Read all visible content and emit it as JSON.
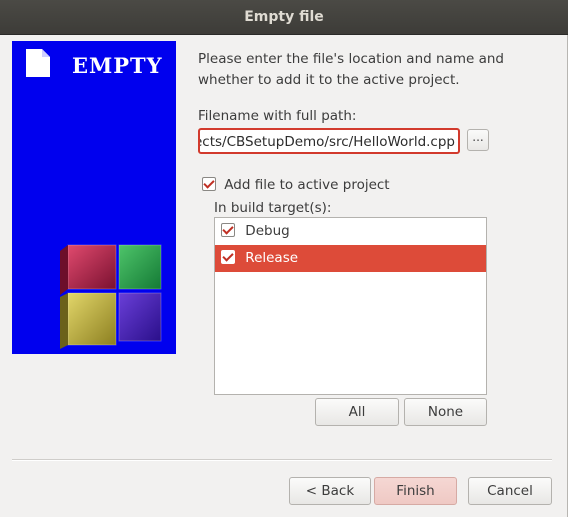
{
  "window": {
    "title": "Empty file"
  },
  "banner": {
    "brand_text": "EMPTY",
    "doc_icon": "document-icon",
    "logo": "cube-logo"
  },
  "intro_text": "Please enter the file's location and name and whether to add it to the active project.",
  "filename": {
    "label": "Filename with full path:",
    "value": "ects/CBSetupDemo/src/HelloWorld.cpp",
    "browse_label": "..."
  },
  "add_to_project": {
    "label": "Add file to active project",
    "checked": true
  },
  "build_targets": {
    "label": "In build target(s):",
    "items": [
      {
        "label": "Debug",
        "checked": true,
        "selected": false
      },
      {
        "label": "Release",
        "checked": true,
        "selected": true
      }
    ],
    "all_label": "All",
    "none_label": "None"
  },
  "footer": {
    "back_label": "< Back",
    "finish_label": "Finish",
    "cancel_label": "Cancel"
  },
  "colors": {
    "accent": "#dd4b39",
    "banner_bg": "#0000ee",
    "titlebar": "#3c3b37"
  }
}
